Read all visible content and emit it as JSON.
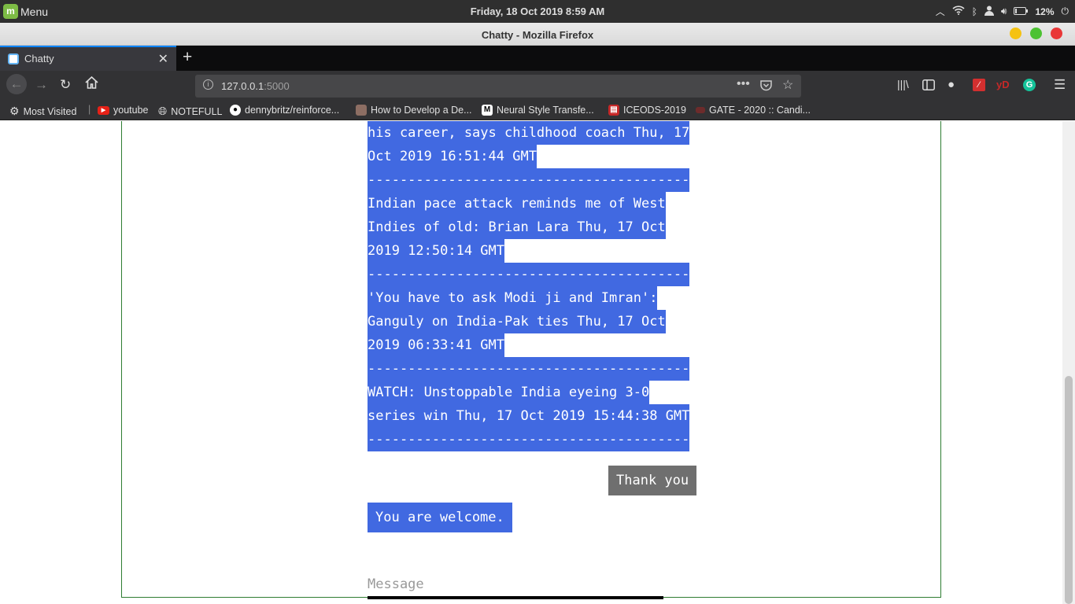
{
  "taskbar": {
    "menu_label": "Menu",
    "clock": "Friday, 18 Oct 2019  8:59 AM",
    "battery": "12%"
  },
  "window": {
    "title": "Chatty - Mozilla Firefox"
  },
  "tab": {
    "title": "Chatty"
  },
  "url": {
    "host": "127.0.0.1",
    "port": ":5000"
  },
  "bookmarks": {
    "items": [
      "Most Visited",
      "youtube",
      "NOTEFULL",
      "dennybritz/reinforce...",
      "How to Develop a De...",
      "Neural Style Transfe...",
      "ICEODS-2019",
      "GATE - 2020 :: Candi..."
    ]
  },
  "chat": {
    "bot_lines": [
      "his career, says childhood coach Thu, 17",
      "Oct 2019 16:51:44 GMT",
      "----------------------------------------",
      "Indian pace attack reminds me of West",
      "Indies of old: Brian Lara Thu, 17 Oct",
      "2019 12:50:14 GMT",
      "----------------------------------------",
      "'You have to ask Modi ji and Imran':",
      "Ganguly on India-Pak ties Thu, 17 Oct",
      "2019 06:33:41 GMT",
      "----------------------------------------",
      "WATCH: Unstoppable India eyeing 3-0",
      "series win Thu, 17 Oct 2019 15:44:38 GMT",
      "----------------------------------------"
    ],
    "user_message": "Thank you",
    "bot_reply": "You are welcome.",
    "input_placeholder": "Message"
  },
  "colors": {
    "bot_bubble": "#4169e1",
    "user_bubble": "#6f6f6f",
    "border": "#2e7d32"
  }
}
